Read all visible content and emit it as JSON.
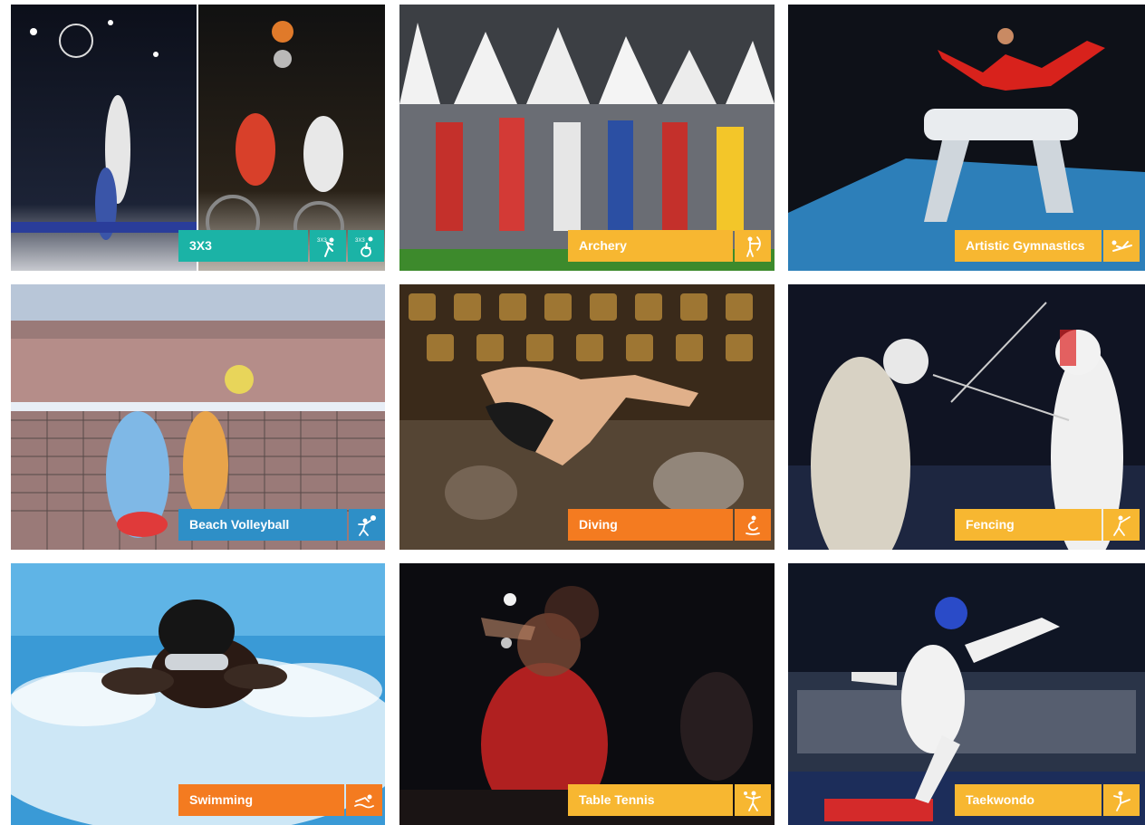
{
  "colors": {
    "teal": "#1bb3a6",
    "yellow": "#f7b731",
    "orange": "#f47b20",
    "blue": "#2e8fc7"
  },
  "tiles": [
    {
      "label": "3X3",
      "color": "#1bb3a6",
      "icons": [
        "3x3-basketball-icon",
        "3x3-wheelchair-basketball-icon"
      ]
    },
    {
      "label": "Archery",
      "color": "#f7b731",
      "icons": [
        "archery-icon"
      ]
    },
    {
      "label": "Artistic Gymnastics",
      "color": "#f7b731",
      "icons": [
        "gymnastics-icon"
      ]
    },
    {
      "label": "Beach Volleyball",
      "color": "#2e8fc7",
      "icons": [
        "beach-volleyball-icon"
      ]
    },
    {
      "label": "Diving",
      "color": "#f47b20",
      "icons": [
        "diving-icon"
      ]
    },
    {
      "label": "Fencing",
      "color": "#f7b731",
      "icons": [
        "fencing-icon"
      ]
    },
    {
      "label": "Swimming",
      "color": "#f47b20",
      "icons": [
        "swimming-icon"
      ]
    },
    {
      "label": "Table Tennis",
      "color": "#f7b731",
      "icons": [
        "table-tennis-icon"
      ]
    },
    {
      "label": "Taekwondo",
      "color": "#f7b731",
      "icons": [
        "taekwondo-icon"
      ]
    }
  ]
}
